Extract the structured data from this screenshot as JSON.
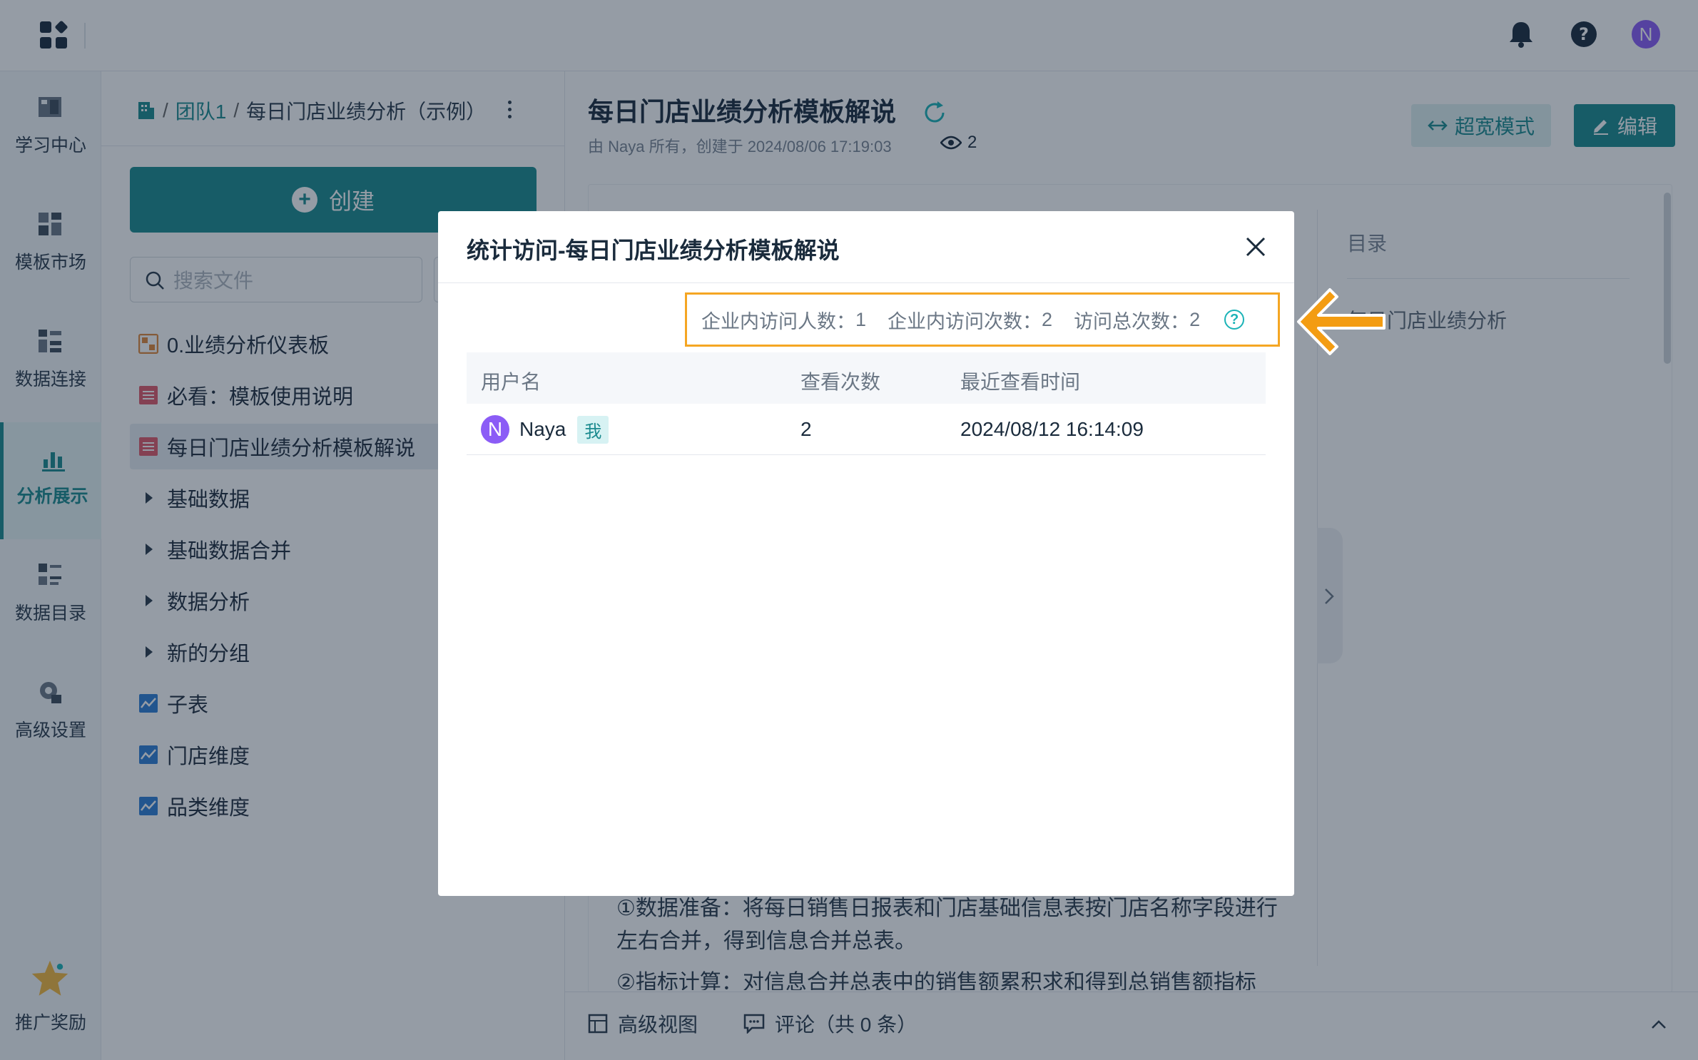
{
  "topbar": {
    "icons": [
      "apps-grid-icon",
      "bell-icon",
      "help-icon"
    ],
    "avatar_initial": "N"
  },
  "leftnav": {
    "items": [
      {
        "label": "学习中心",
        "icon": "book-icon"
      },
      {
        "label": "模板市场",
        "icon": "template-icon"
      },
      {
        "label": "数据连接",
        "icon": "data-connect-icon"
      },
      {
        "label": "分析展示",
        "icon": "analysis-icon",
        "active": true
      },
      {
        "label": "数据目录",
        "icon": "catalog-icon"
      },
      {
        "label": "高级设置",
        "icon": "settings-icon"
      },
      {
        "label": "推广奖励",
        "icon": "star-reward-icon"
      }
    ]
  },
  "tree": {
    "breadcrumb": {
      "sep": "/",
      "team": "团队1",
      "current": "每日门店业绩分析（示例）"
    },
    "create_label": "创建",
    "search_placeholder": "搜索文件",
    "items": [
      {
        "label": "0.业绩分析仪表板",
        "type": "dashboard"
      },
      {
        "label": "必看：模板使用说明",
        "type": "doc"
      },
      {
        "label": "每日门店业绩分析模板解说",
        "type": "doc",
        "selected": true
      },
      {
        "label": "基础数据",
        "type": "folder"
      },
      {
        "label": "基础数据合并",
        "type": "folder"
      },
      {
        "label": "数据分析",
        "type": "folder"
      },
      {
        "label": "新的分组",
        "type": "folder"
      },
      {
        "label": "子表",
        "type": "chart"
      },
      {
        "label": "门店维度",
        "type": "chart"
      },
      {
        "label": "品类维度",
        "type": "chart"
      }
    ]
  },
  "main": {
    "title": "每日门店业绩分析模板解说",
    "meta": "由 Naya 所有，创建于 2024/08/06 17:19:03",
    "view_count": "2",
    "wide_mode_label": "超宽模式",
    "edit_label": "编辑",
    "toc_title": "目录",
    "toc_item": "每日门店业绩分析",
    "para1_line1": "①数据准备：将每日销售日报表和门店基础信息表按门店名称字段进行",
    "para1_line2": "左右合并，得到信息合并总表。",
    "para2_line1": "②指标计算：对信息合并总表中的销售额累积求和得到总销售额指标",
    "advanced_view_label": "高级视图",
    "comments_label": "评论（共 0 条）"
  },
  "modal": {
    "title": "统计访问-每日门店业绩分析模板解说",
    "stats": {
      "visitors_label": "企业内访问人数：",
      "visitors": "1",
      "visits_label": "企业内访问次数：",
      "visits": "2",
      "total_label": "访问总次数：",
      "total": "2"
    },
    "columns": [
      "用户名",
      "查看次数",
      "最近查看时间"
    ],
    "rows": [
      {
        "avatar": "N",
        "user": "Naya",
        "badge": "我",
        "views": "2",
        "last_viewed": "2024/08/12 16:14:09"
      }
    ]
  },
  "colors": {
    "brand": "#1b8a8f",
    "highlight_border": "#f5a623",
    "annotation_arrow": "#f39c12",
    "avatar": "#8b5cf6"
  }
}
